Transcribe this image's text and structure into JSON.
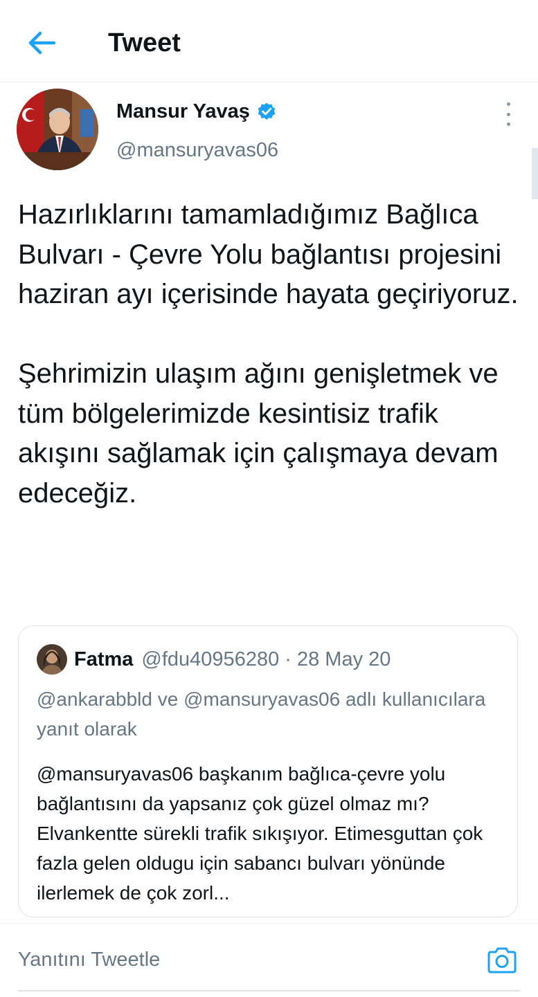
{
  "header": {
    "title": "Tweet",
    "back_icon": "arrow-left-icon"
  },
  "colors": {
    "accent": "#1da1f2",
    "secondary_text": "#657786",
    "border": "#e6ecf0"
  },
  "tweet": {
    "author_name": "Mansur Yavaş",
    "verified": true,
    "handle": "@mansuryavas06",
    "paragraphs": [
      "Hazırlıklarını tamamladığımız Bağlıca Bulvarı - Çevre Yolu bağlantısı projesini haziran ayı içerisinde hayata geçiriyoruz.",
      "Şehrimizin ulaşım ağını genişletmek ve tüm bölgelerimizde kesintisiz trafik akışını sağlamak için çalışmaya devam edeceğiz."
    ]
  },
  "quoted": {
    "author_name": "Fatma",
    "meta": "@fdu40956280 · 28 May 20",
    "reply_context": "@ankarabbld ve @mansuryavas06 adlı kullanıcılara yanıt olarak",
    "text": "@mansuryavas06 başkanım bağlıca-çevre yolu bağlantısını da yapsanız çok güzel olmaz mı? Elvankentte sürekli trafik sıkışıyor. Etimesguttan çok fazla gelen oldugu için sabancı bulvarı yönünde ilerlemek de çok zorl..."
  },
  "reply": {
    "placeholder": "Yanıtını Tweetle",
    "camera_icon": "camera-icon"
  }
}
